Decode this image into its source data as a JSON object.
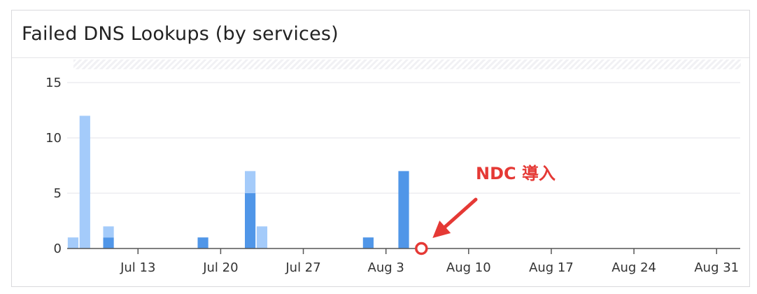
{
  "widget": {
    "title": "Failed DNS Lookups (by services)"
  },
  "chart_data": {
    "type": "bar",
    "stacked": true,
    "x_start": "Jul 7",
    "x_end": "Sep 2",
    "ylim": [
      0,
      15
    ],
    "yticks": [
      0,
      5,
      10,
      15
    ],
    "xticks": [
      "Jul 13",
      "Jul 20",
      "Jul 27",
      "Aug 3",
      "Aug 10",
      "Aug 17",
      "Aug 24",
      "Aug 31"
    ],
    "grid": true,
    "colors": {
      "series_a": "#5096e8",
      "series_b": "#a4cbfa"
    },
    "bars": [
      {
        "date": "Jul 7",
        "a": 0,
        "b": 1
      },
      {
        "date": "Jul 8",
        "a": 0,
        "b": 12
      },
      {
        "date": "Jul 10",
        "a": 1,
        "b": 1
      },
      {
        "date": "Jul 18",
        "a": 1,
        "b": 0
      },
      {
        "date": "Jul 22",
        "a": 5,
        "b": 2
      },
      {
        "date": "Jul 23",
        "a": 0,
        "b": 2
      },
      {
        "date": "Aug 1",
        "a": 1,
        "b": 0
      },
      {
        "date": "Aug 4",
        "a": 7,
        "b": 0
      }
    ],
    "annotation": {
      "text": "NDC 導入",
      "date": "Aug 6",
      "value": 0,
      "color": "#e53935"
    }
  }
}
